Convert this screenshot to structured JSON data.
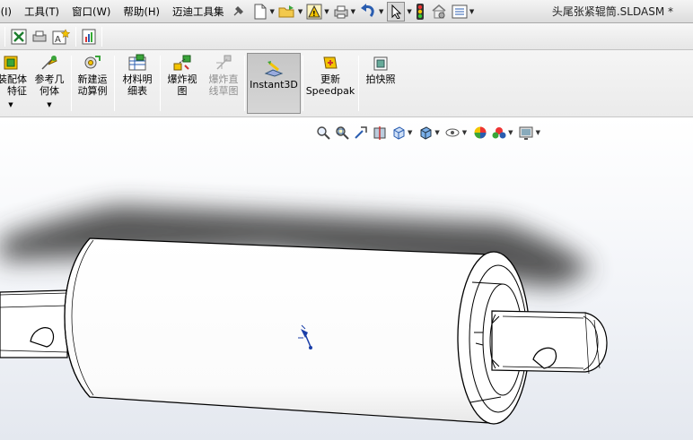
{
  "menu": {
    "items": [
      "(I)",
      "工具(T)",
      "窗口(W)",
      "帮助(H)",
      "迈迪工具集"
    ]
  },
  "window": {
    "title": "头尾张紧辊筒.SLDASM *"
  },
  "commands": {
    "assembly_feature": "装配体\n特征",
    "reference_geometry": "参考几\n何体",
    "new_motion_study": "新建运\n动算例",
    "bill_of_materials": "材料明\n细表",
    "exploded_view": "爆炸视\n图",
    "explode_line_sketch": "爆炸直\n线草图",
    "instant3d": "Instant3D",
    "update_speedpak": "更新\nSpeedpak",
    "take_snapshot": "拍快照"
  },
  "colors": {
    "accent_blue": "#2a5db0",
    "active_button": "#c9c9c9",
    "viewport_bottom": "#e4e8ef"
  },
  "icons": [
    "pin-icon",
    "new-document-icon",
    "open-folder-icon",
    "rebuild-icon",
    "print-icon",
    "undo-icon",
    "select-arrow-icon",
    "traffic-light-icon",
    "options-icon",
    "list-icon",
    "zoom-fit-icon",
    "zoom-area-icon",
    "previous-view-icon",
    "section-view-icon",
    "view-orientation-icon",
    "display-style-icon",
    "hide-show-icon",
    "appearance-icon",
    "scene-icon",
    "view-settings-icon"
  ]
}
